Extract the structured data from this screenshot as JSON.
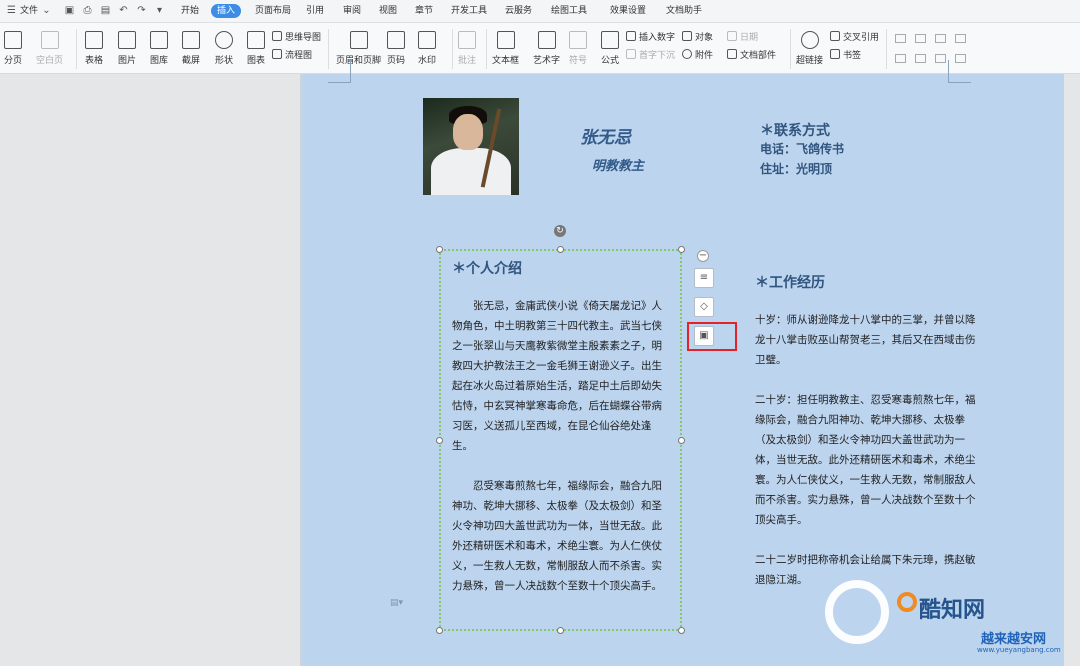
{
  "menubar": {
    "file": "文件",
    "tabs": [
      "开始",
      "插入",
      "页面布局",
      "引用",
      "审阅",
      "视图",
      "章节",
      "开发工具",
      "云服务",
      "绘图工具",
      "效果设置",
      "文档助手"
    ],
    "active_tab": "插入"
  },
  "ribbon": {
    "page_break": "分页",
    "blank_page": "空白页",
    "table": "表格",
    "picture": "图片",
    "gallery": "图库",
    "screenshot": "截屏",
    "shape": "形状",
    "chart": "图表",
    "mindmap": "思维导图",
    "flowchart": "流程图",
    "header_footer": "页眉和页脚",
    "page_number": "页码",
    "watermark": "水印",
    "comment": "批注",
    "textbox": "文本框",
    "wordart": "艺术字",
    "symbol": "符号",
    "formula": "公式",
    "insert_number": "插入数字",
    "object": "对象",
    "date": "日期",
    "first_drop": "首字下沉",
    "attachment": "附件",
    "doc_parts": "文档部件",
    "hyperlink": "超链接",
    "cross_ref": "交叉引用",
    "bookmark": "书签"
  },
  "document": {
    "name": "张无忌",
    "title": "明教教主",
    "contact_heading": "＊联系方式",
    "phone": "电话：飞鸽传书",
    "address": "住址：光明顶",
    "intro_heading": "＊个人介绍",
    "intro_p1": "张无忌，金庸武侠小说《倚天屠龙记》人物角色，中土明教第三十四代教主。武当七侠之一张翠山与天鹰教紫微堂主殷素素之子，明教四大护教法王之一金毛狮王谢逊义子。出生起在冰火岛过着原始生活，踏足中土后即幼失怙恃，中玄冥神掌寒毒命危，后在蝴蝶谷带病习医，义送孤儿至西域，在昆仑仙谷绝处逢生。",
    "intro_p2": "忍受寒毒煎熬七年，福缘际会，融合九阳神功、乾坤大挪移、太极拳（及太极剑）和圣火令神功四大盖世武功为一体，当世无敌。此外还精研医术和毒术，术绝尘寰。为人仁侠仗义，一生救人无数，常制服敌人而不杀害。实力悬殊，曾一人决战数个至数十个顶尖高手。",
    "work_heading": "＊工作经历",
    "work_p1": "十岁：师从谢逊降龙十八掌中的三掌，并曾以降龙十八掌击败巫山帮贺老三，其后又在西域击伤卫璧。",
    "work_p2": "二十岁：担任明教教主、忍受寒毒煎熬七年，福缘际会，融合九阳神功、乾坤大挪移、太极拳（及太极剑）和圣火令神功四大盖世武功为一体，当世无敌。此外还精研医术和毒术，术绝尘寰。为人仁侠仗义，一生救人无数，常制服敌人而不杀害。实力悬殊，曾一人决战数个至数十个顶尖高手。",
    "work_p3": "二十二岁时把称帝机会让给属下朱元璋，携赵敏退隐江湖。"
  },
  "watermark": {
    "brand": "酷知网",
    "site": "越来越安网",
    "url": "www.yueyangbang.com"
  },
  "colors": {
    "page": "#bcd4ee",
    "heading": "#31557f",
    "accent": "#3d8de6",
    "selection": "#7fca6c",
    "highlight": "#e3232b"
  }
}
